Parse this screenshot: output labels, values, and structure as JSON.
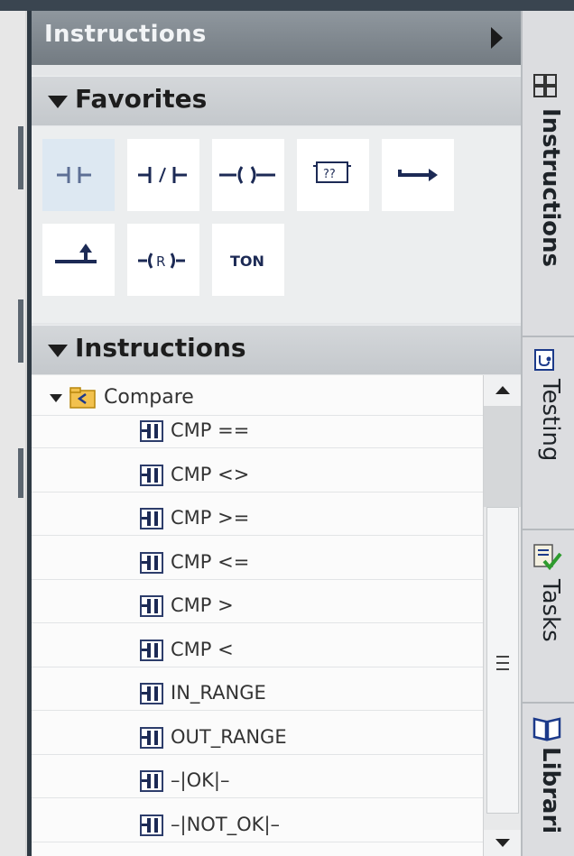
{
  "panel": {
    "title": "Instructions"
  },
  "favorites": {
    "title": "Favorites",
    "items": [
      {
        "name": "normally-open-contact",
        "label": ""
      },
      {
        "name": "normally-closed-contact",
        "label": ""
      },
      {
        "name": "output-coil",
        "label": ""
      },
      {
        "name": "empty-box",
        "label": "??"
      },
      {
        "name": "open-branch",
        "label": ""
      },
      {
        "name": "close-branch",
        "label": ""
      },
      {
        "name": "reset-output",
        "label": "R"
      },
      {
        "name": "ton-timer",
        "label": "TON"
      }
    ]
  },
  "instructions": {
    "title": "Instructions",
    "folder": "Compare",
    "items": [
      "CMP ==",
      "CMP <>",
      "CMP >=",
      "CMP <=",
      "CMP >",
      "CMP <",
      "IN_RANGE",
      "OUT_RANGE",
      "–|OK|–",
      "–|NOT_OK|–"
    ]
  },
  "side_tabs": [
    {
      "label": "Instructions",
      "icon": "instructions-grid-icon",
      "active": true
    },
    {
      "label": "Testing",
      "icon": "testing-icon",
      "active": false
    },
    {
      "label": "Tasks",
      "icon": "tasks-icon",
      "active": false
    },
    {
      "label": "Librari",
      "icon": "libraries-book-icon",
      "active": false
    }
  ],
  "colors": {
    "header": "#7f878e",
    "section": "#c9cdd1",
    "icon_blue": "#1c2a55",
    "folder": "#f2c14e"
  }
}
